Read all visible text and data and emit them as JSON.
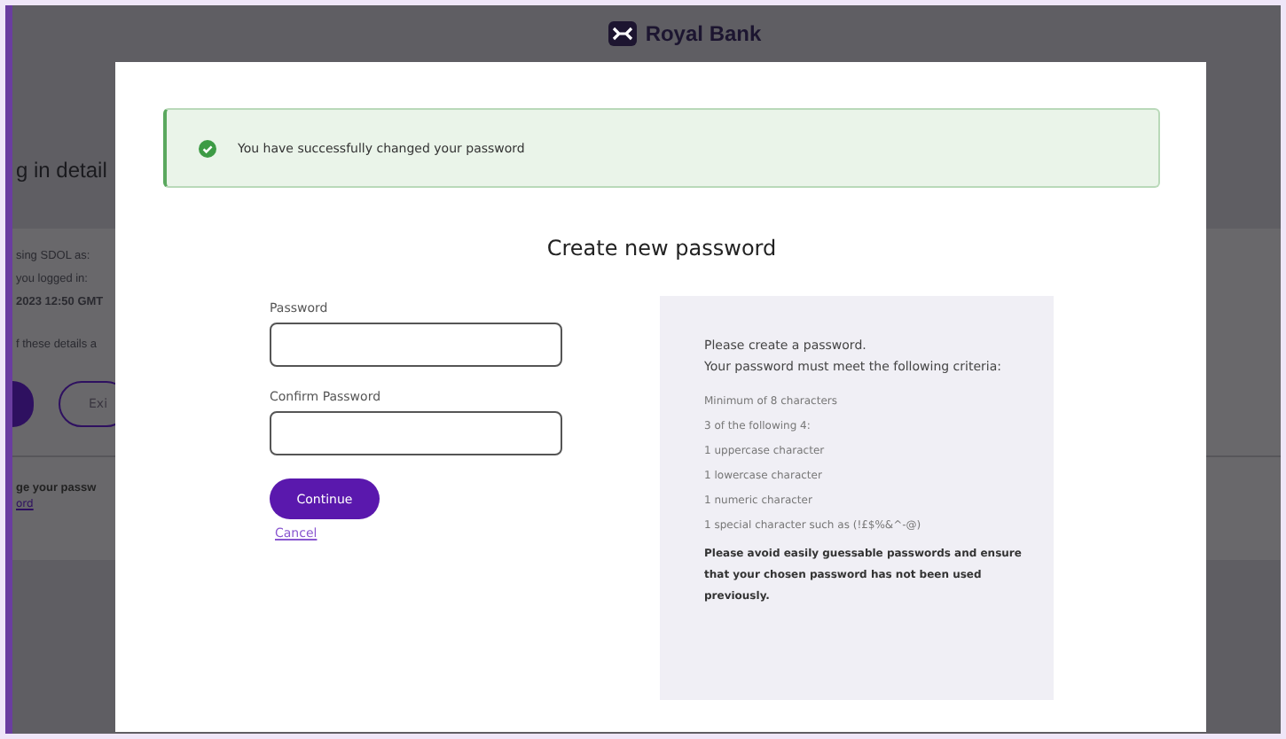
{
  "background_page": {
    "brand": "Royal Bank",
    "heading": "g in detail",
    "panel_lines": [
      {
        "text": "sing SDOL as:",
        "kind": "plain"
      },
      {
        "text": "you logged in:",
        "kind": "plain"
      },
      {
        "text": "2023 12:50 GMT",
        "kind": "bold"
      },
      {
        "text": "f these details a",
        "kind": "warning"
      }
    ],
    "exit_button": "Exi",
    "section_title": "ge your passw",
    "section_link": "ord"
  },
  "dialog": {
    "alert": "You have successfully changed your password",
    "title": "Create new password",
    "fields": [
      {
        "label": "Password"
      },
      {
        "label": "Confirm Password"
      }
    ],
    "continue_button": "Continue",
    "cancel_link": "Cancel",
    "criteria": {
      "intro": [
        "Please create a password.",
        "Your password must meet the following criteria:"
      ],
      "rules": [
        "Minimum of 8 characters",
        "3 of the following 4:",
        "1 uppercase character",
        "1 lowercase character",
        "1 numeric character",
        "1 special character such as (!£$%&^-@)"
      ],
      "note": "Please avoid easily guessable passwords and ensure that your chosen password has not been used previously."
    }
  }
}
